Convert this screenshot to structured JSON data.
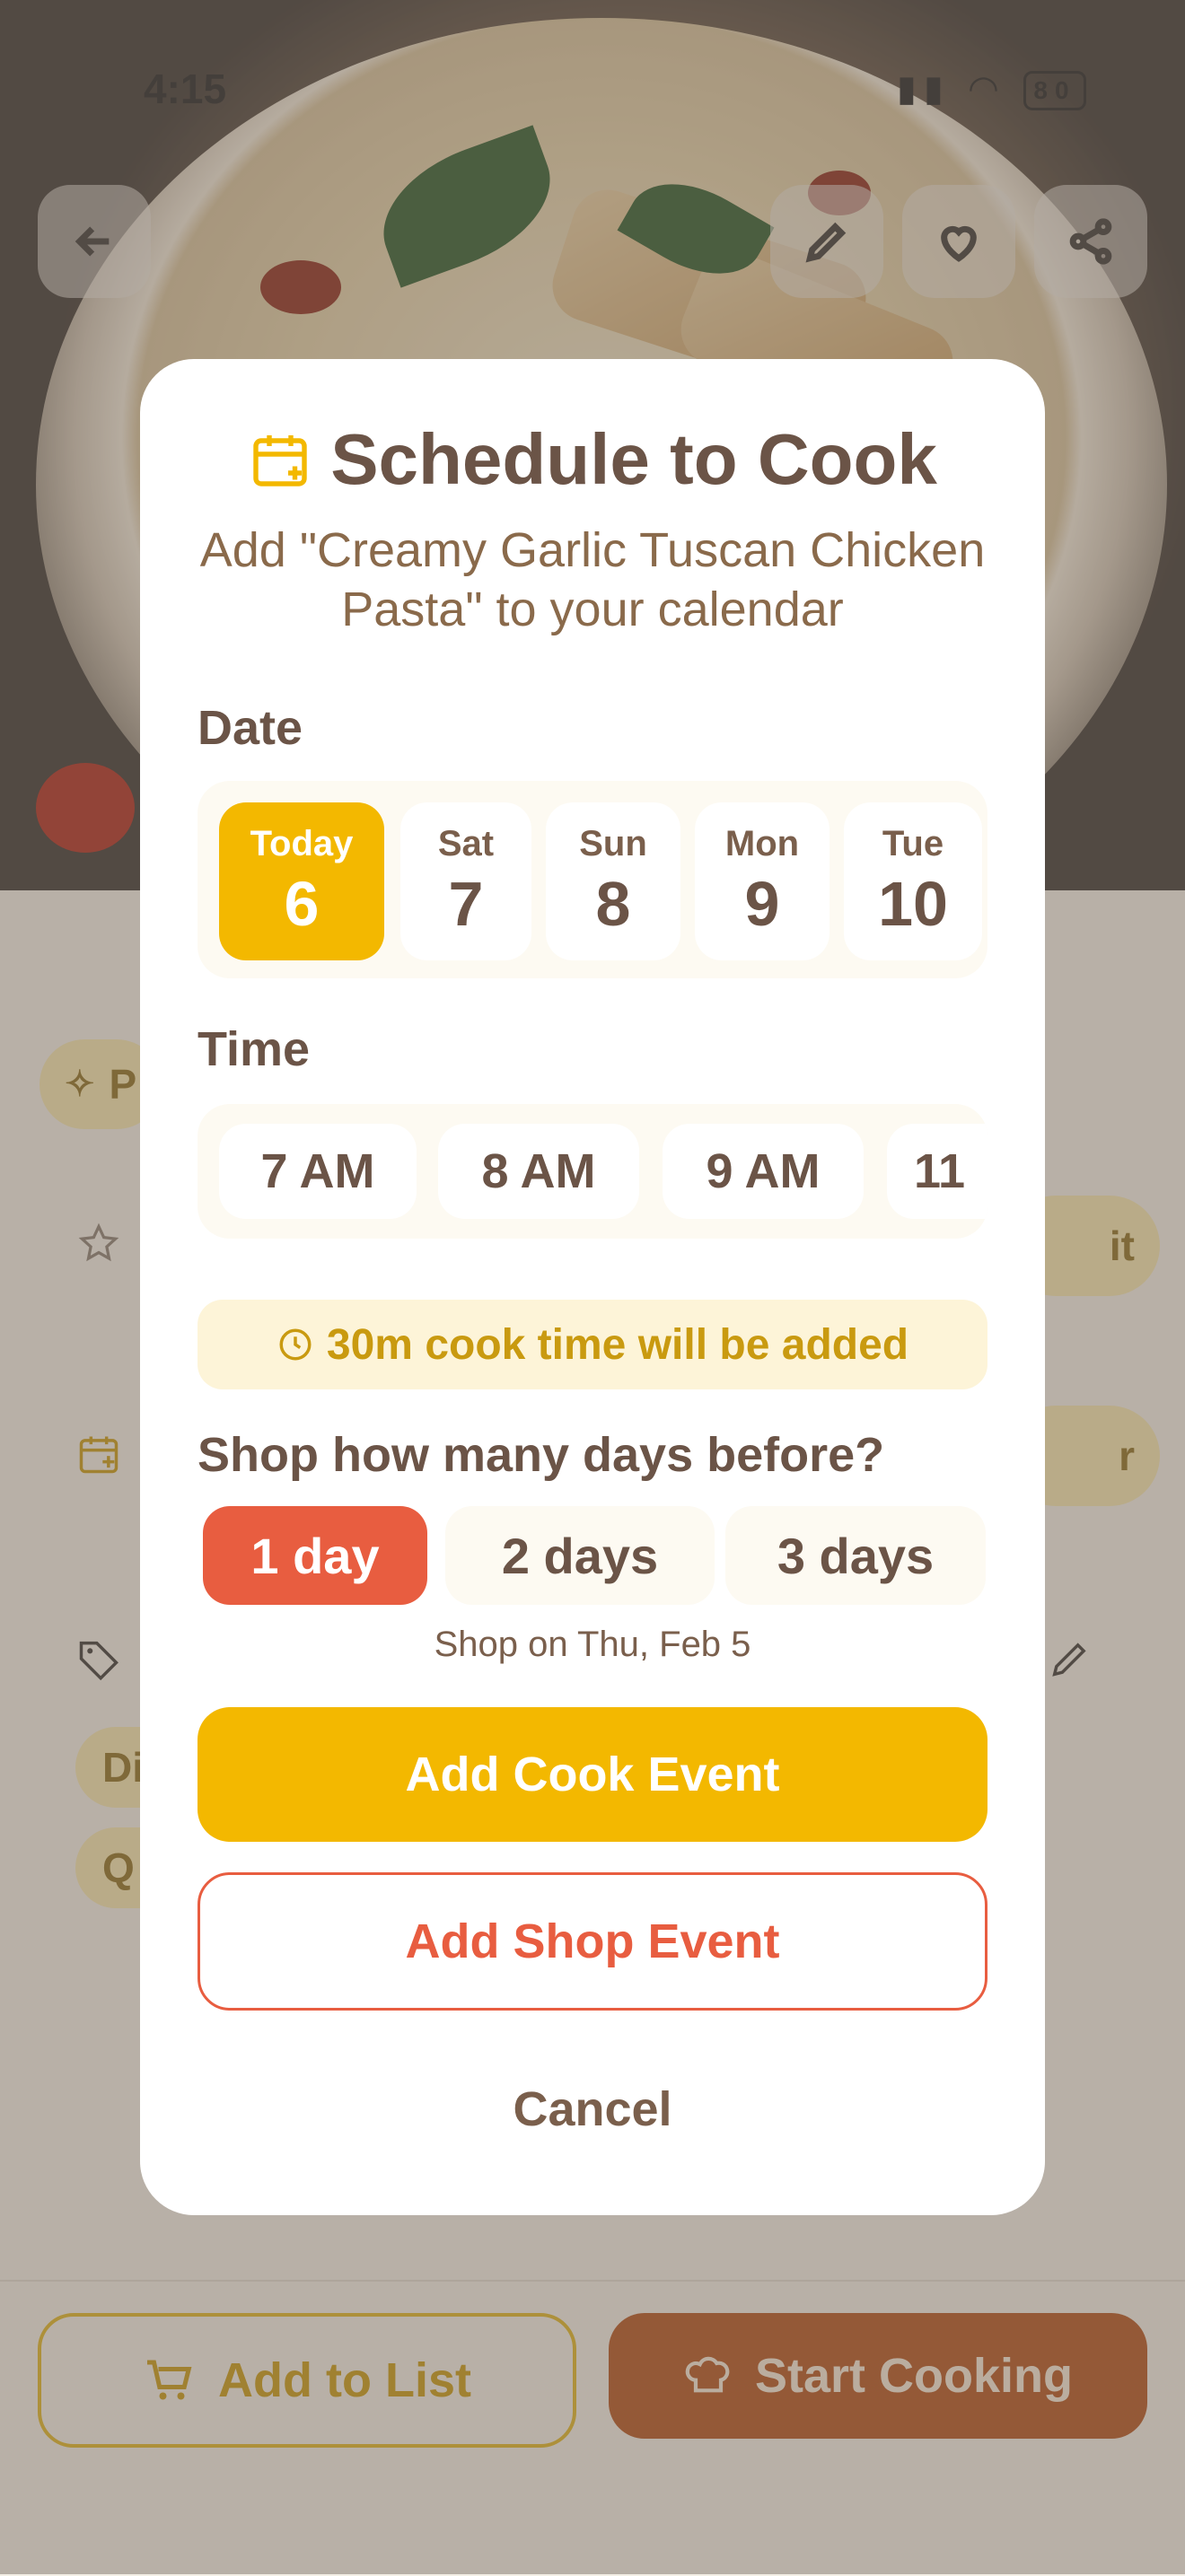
{
  "status_bar": {
    "time": "4:15",
    "battery": "80"
  },
  "colors": {
    "accent_yellow": "#f3b800",
    "accent_red": "#e85d40",
    "text_brown": "#6b5447"
  },
  "background": {
    "chip_partial": "P",
    "button_partial_1": "it",
    "button_partial_2": "r",
    "tag_partial_1": "Di",
    "tag_partial_2": "Q",
    "add_to_list": "Add to List",
    "start_cooking": "Start Cooking"
  },
  "modal": {
    "title": "Schedule to Cook",
    "subtitle": "Add \"Creamy Garlic Tuscan Chicken Pasta\" to your calendar",
    "date_label": "Date",
    "dates": [
      {
        "dow": "Today",
        "num": "6",
        "selected": true
      },
      {
        "dow": "Sat",
        "num": "7",
        "selected": false
      },
      {
        "dow": "Sun",
        "num": "8",
        "selected": false
      },
      {
        "dow": "Mon",
        "num": "9",
        "selected": false
      },
      {
        "dow": "Tue",
        "num": "10",
        "selected": false
      }
    ],
    "time_label": "Time",
    "times": [
      "7 AM",
      "8 AM",
      "9 AM",
      "11"
    ],
    "cook_note": "30m cook time will be added",
    "shop_label": "Shop how many days before?",
    "shop_days": [
      {
        "label": "1 day",
        "selected": true
      },
      {
        "label": "2 days",
        "selected": false
      },
      {
        "label": "3 days",
        "selected": false
      }
    ],
    "shop_on": "Shop on Thu, Feb 5",
    "add_cook_event": "Add Cook Event",
    "add_shop_event": "Add Shop Event",
    "cancel": "Cancel"
  }
}
